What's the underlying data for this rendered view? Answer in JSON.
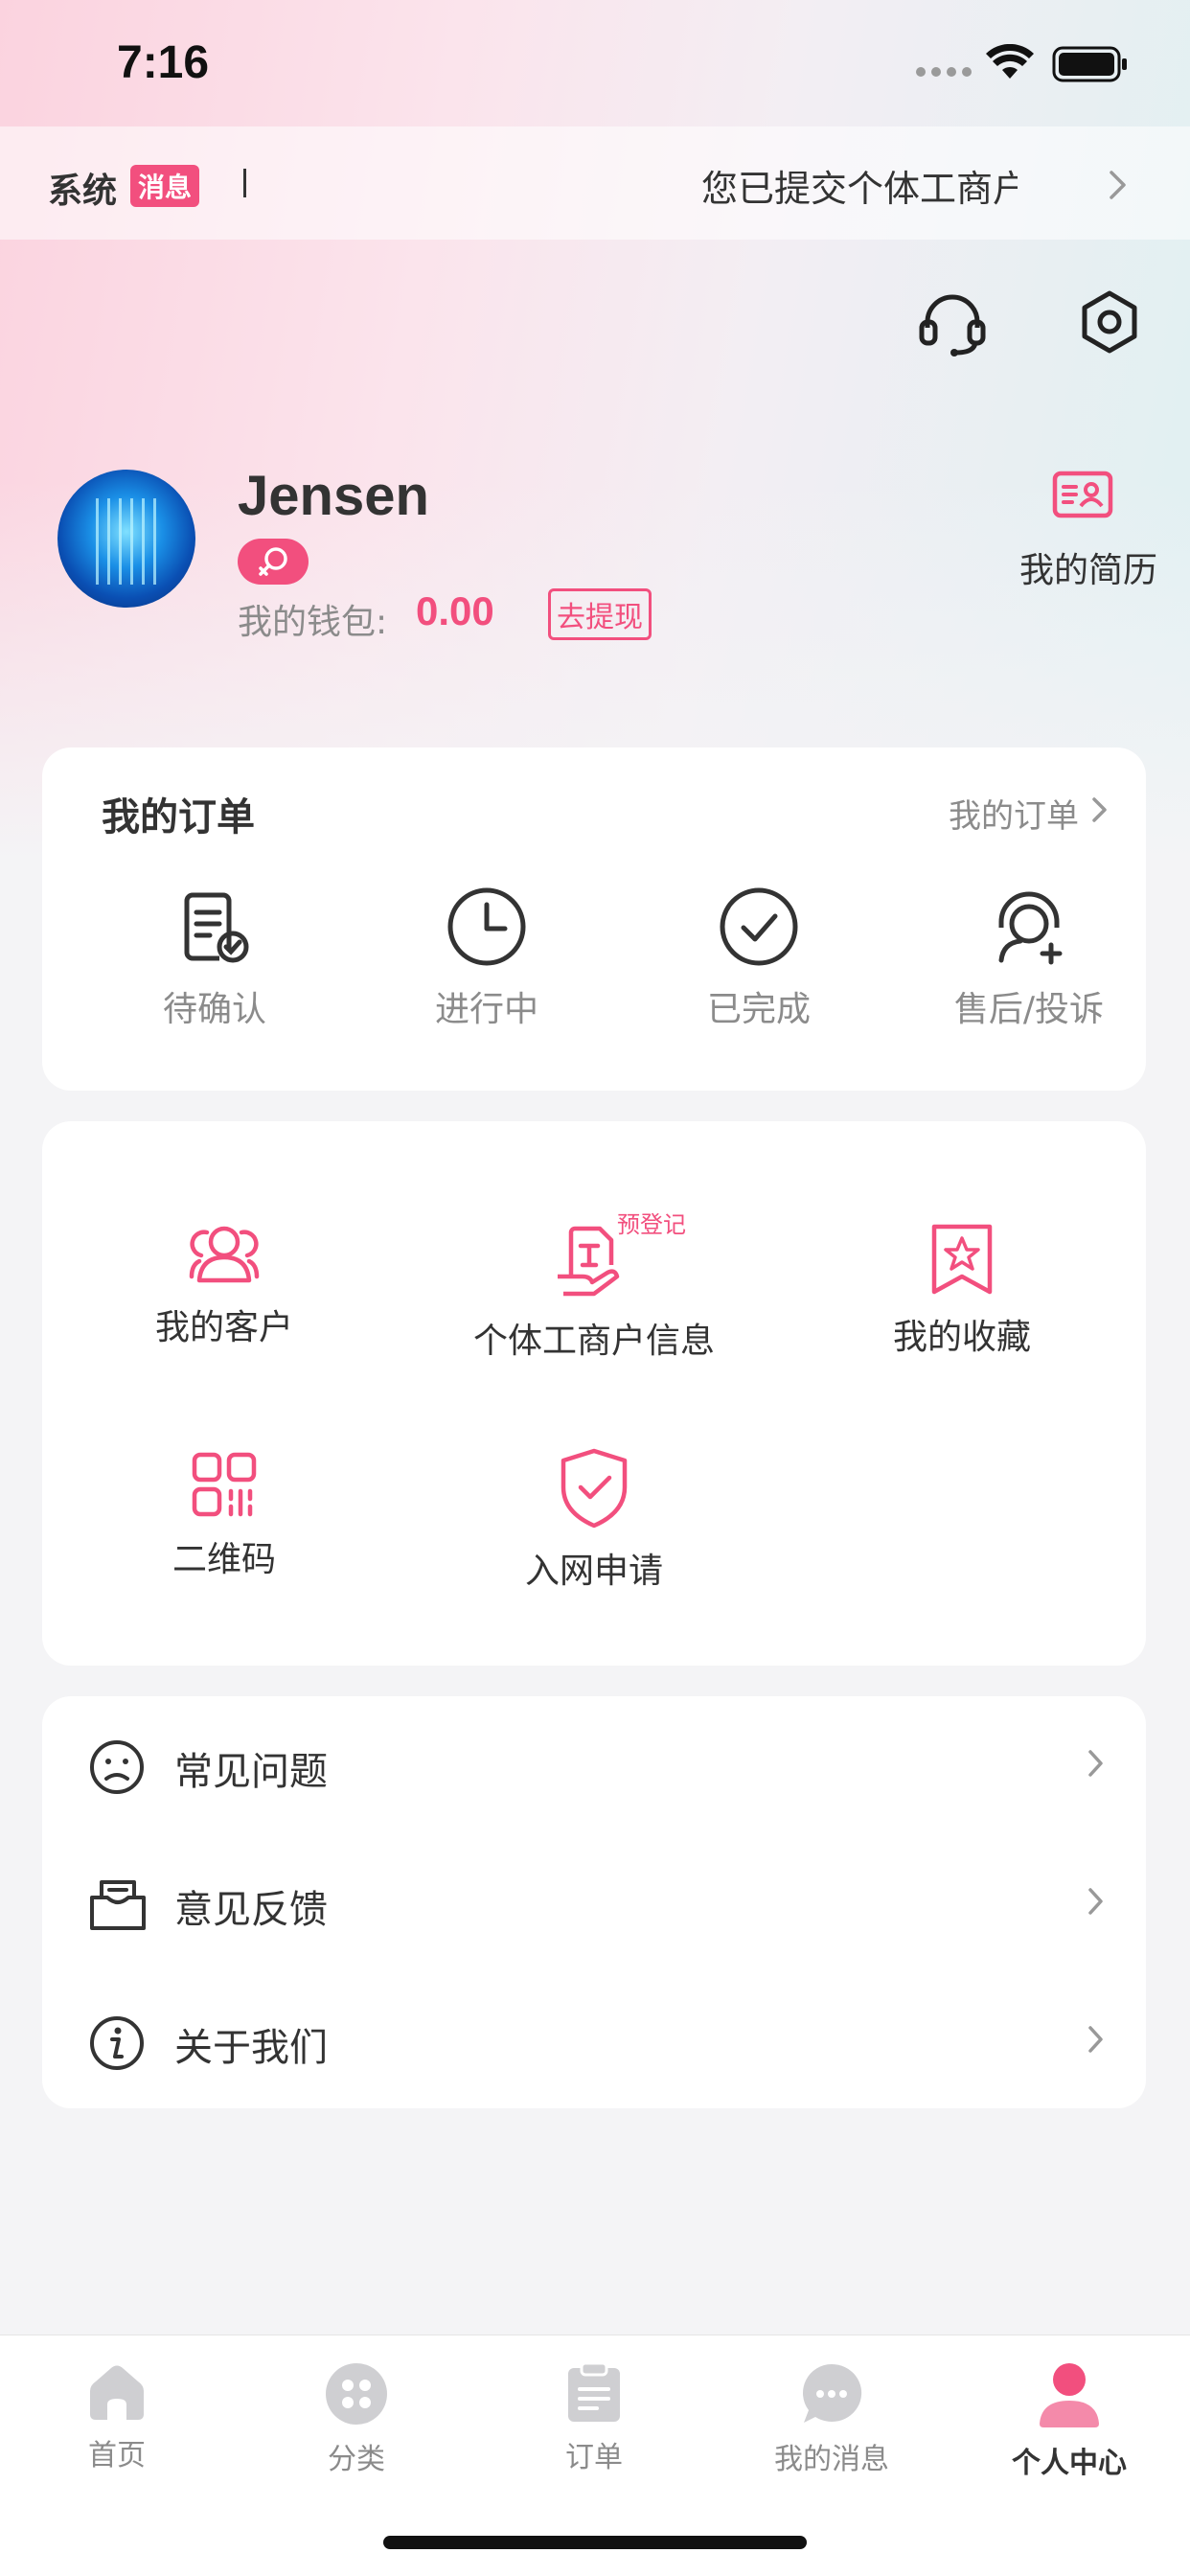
{
  "status_bar": {
    "time": "7:16"
  },
  "system_message": {
    "title": "系统",
    "badge": "消息",
    "text": "您已提交个体工商户信息"
  },
  "profile": {
    "username": "Jensen",
    "wallet_label": "我的钱包:",
    "wallet_value": "0.00",
    "withdraw_label": "去提现",
    "resume_label": "我的简历"
  },
  "orders": {
    "title": "我的订单",
    "more_label": "我的订单",
    "items": [
      {
        "label": "待确认",
        "icon": "pending-confirm-icon"
      },
      {
        "label": "进行中",
        "icon": "clock-icon"
      },
      {
        "label": "已完成",
        "icon": "check-circle-icon"
      },
      {
        "label": "售后/投诉",
        "icon": "support-agent-icon"
      }
    ]
  },
  "services": {
    "items": [
      {
        "label": "我的客户",
        "icon": "customers-icon"
      },
      {
        "label": "个体工商户信息",
        "icon": "business-info-icon",
        "tag": "预登记"
      },
      {
        "label": "我的收藏",
        "icon": "favorites-icon"
      },
      {
        "label": "二维码",
        "icon": "qr-code-icon"
      },
      {
        "label": "入网申请",
        "icon": "shield-check-icon"
      }
    ]
  },
  "menu": {
    "items": [
      {
        "label": "常见问题",
        "icon": "faq-face-icon"
      },
      {
        "label": "意见反馈",
        "icon": "feedback-mail-icon"
      },
      {
        "label": "关于我们",
        "icon": "info-icon"
      }
    ]
  },
  "tabbar": {
    "items": [
      {
        "label": "首页",
        "icon": "home-icon"
      },
      {
        "label": "分类",
        "icon": "category-icon"
      },
      {
        "label": "订单",
        "icon": "order-icon"
      },
      {
        "label": "我的消息",
        "icon": "message-icon"
      },
      {
        "label": "个人中心",
        "icon": "profile-icon",
        "active": true
      }
    ]
  },
  "colors": {
    "accent": "#f24f7e",
    "text": "#333333",
    "muted": "#8b8b8b"
  }
}
